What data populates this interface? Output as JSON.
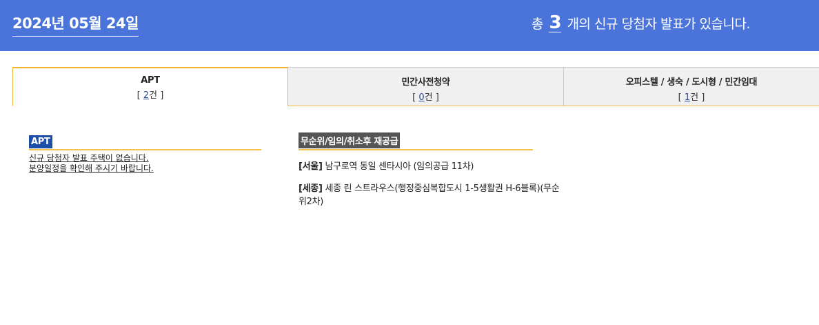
{
  "header": {
    "date": "2024년 05월 24일",
    "summary_prefix": "총",
    "summary_count": "3",
    "summary_suffix": "개의 신규 당첨자 발표가 있습니다."
  },
  "tabs": [
    {
      "name": "APT",
      "open": "[ ",
      "count": "2",
      "close": "건 ]"
    },
    {
      "name": "민간사전청약",
      "open": "[ ",
      "count": "0",
      "close": "건 ]"
    },
    {
      "name": "오피스텔 / 생숙 / 도시형 / 민간임대",
      "open": "[ ",
      "count": "1",
      "close": "건 ]"
    }
  ],
  "apt_section": {
    "title": "APT",
    "notice_line1": "신규 당첨자 발표 주택이 없습니다.",
    "notice_line2": "분양일정을 확인해 주시기 바랍니다."
  },
  "resupply_section": {
    "title": "무순위/임의/취소후 재공급",
    "items": [
      {
        "region": "[서울]",
        "text": " 남구로역 동일 센타시아 (임의공급 11차)"
      },
      {
        "region": "[세종]",
        "text": " 세종 린 스트라우스(행정중심복합도시 1-5생활권 H-6블록)(무순위2차)"
      }
    ]
  },
  "colors": {
    "header_bg": "#4a74d9",
    "tab_accent": "#f2b632",
    "apt_title_bg": "#1e4fa8",
    "resupply_title_bg": "#555555"
  }
}
